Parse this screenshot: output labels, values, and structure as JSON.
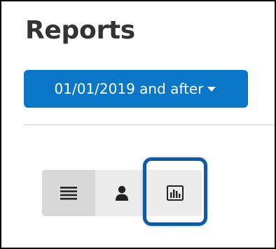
{
  "page": {
    "title": "Reports"
  },
  "filter": {
    "date_label": "01/01/2019 and after",
    "caret_icon": "caret-down-icon",
    "button_color": "#0a76c8"
  },
  "view_toggle": {
    "buttons": [
      {
        "icon": "list-icon",
        "active": true
      },
      {
        "icon": "user-icon",
        "active": false
      },
      {
        "icon": "bar-chart-icon",
        "active": false,
        "highlighted": true
      }
    ],
    "highlight_color": "#0f5aa3"
  }
}
